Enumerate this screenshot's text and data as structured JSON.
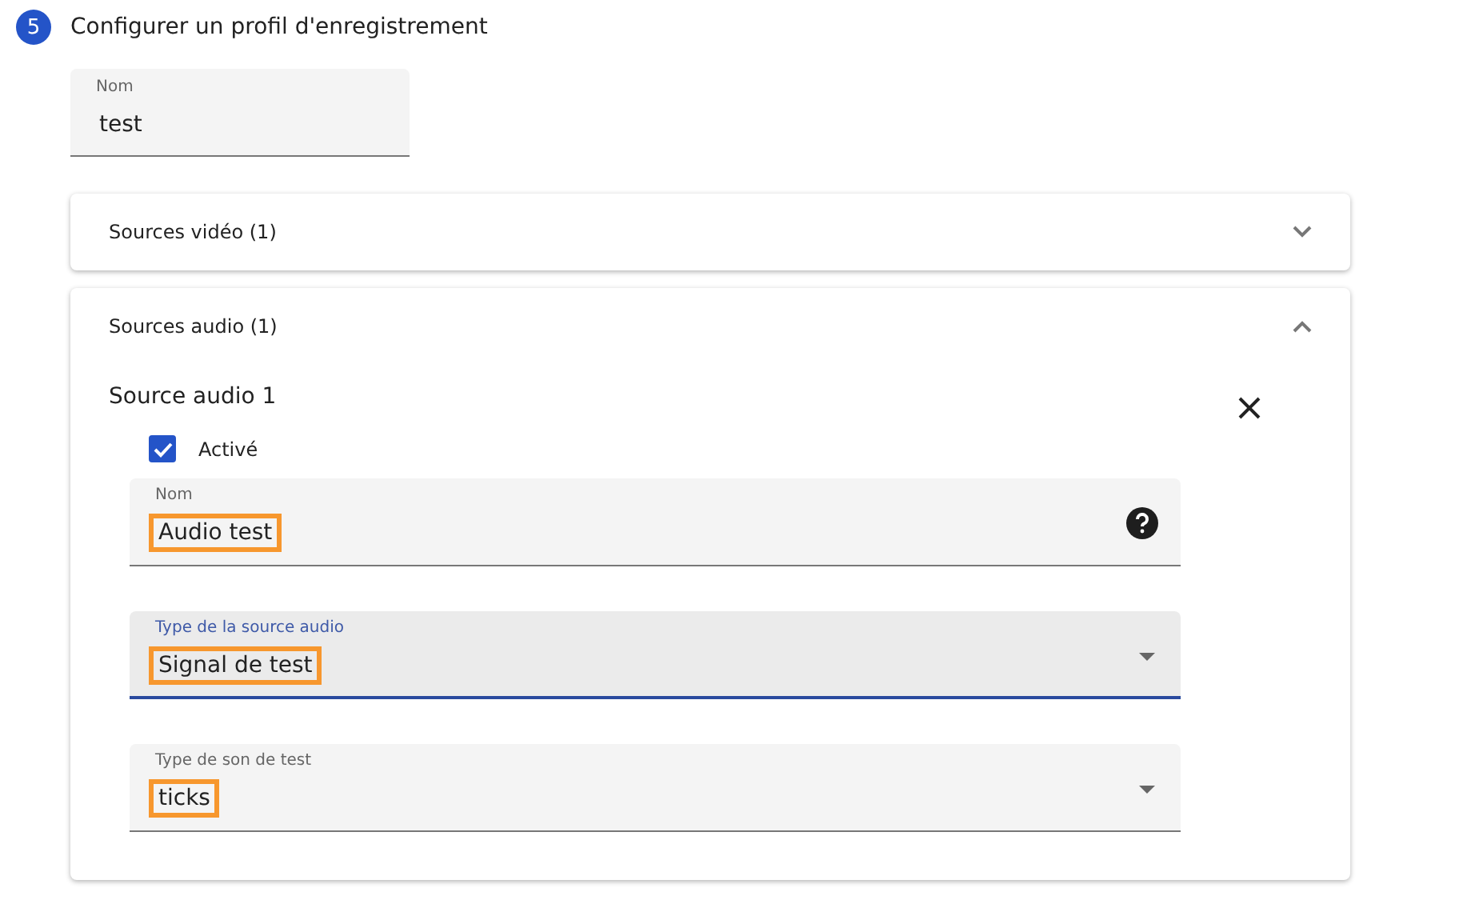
{
  "step": {
    "number": "5",
    "title": "Configurer un profil d'enregistrement"
  },
  "name_field": {
    "label": "Nom",
    "value": "test"
  },
  "panels": [
    {
      "title": "Sources vidéo (1)",
      "expanded": false
    },
    {
      "title": "Sources audio (1)",
      "expanded": true,
      "source": {
        "title": "Source audio 1",
        "enabled": {
          "label": "Activé",
          "checked": true
        },
        "fields": [
          {
            "kind": "text",
            "label": "Nom",
            "value": "Audio test",
            "focused": false,
            "highlighted": true
          },
          {
            "kind": "select",
            "label": "Type de la source audio",
            "value": "Signal de test",
            "focused": true,
            "highlighted": true
          },
          {
            "kind": "select",
            "label": "Type de son de test",
            "value": "ticks",
            "focused": false,
            "highlighted": true
          }
        ]
      }
    }
  ]
}
